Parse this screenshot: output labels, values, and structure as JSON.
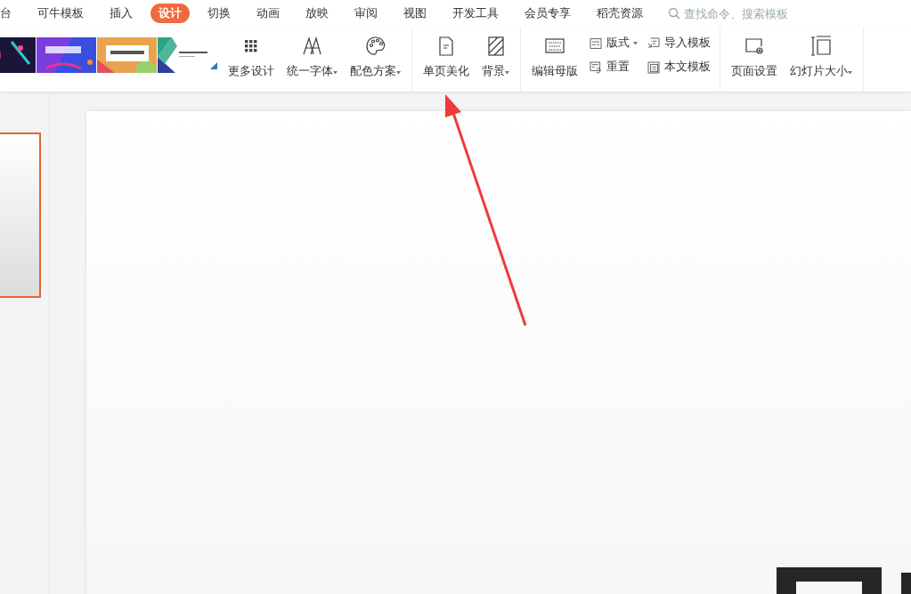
{
  "tabs": [
    {
      "label": "台",
      "selected": false
    },
    {
      "label": "可牛模板",
      "selected": false
    },
    {
      "label": "插入",
      "selected": false
    },
    {
      "label": "设计",
      "selected": true
    },
    {
      "label": "切换",
      "selected": false
    },
    {
      "label": "动画",
      "selected": false
    },
    {
      "label": "放映",
      "selected": false
    },
    {
      "label": "审阅",
      "selected": false
    },
    {
      "label": "视图",
      "selected": false
    },
    {
      "label": "开发工具",
      "selected": false
    },
    {
      "label": "会员专享",
      "selected": false
    },
    {
      "label": "稻壳资源",
      "selected": false
    }
  ],
  "search": {
    "placeholder": "查找命令、搜索模板"
  },
  "ribbon": {
    "groups": [
      {
        "items": [
          {
            "kind": "large",
            "label": "更多设计",
            "dropdown": false
          },
          {
            "kind": "large",
            "label": "统一字体",
            "dropdown": true
          },
          {
            "kind": "large",
            "label": "配色方案",
            "dropdown": true
          }
        ]
      },
      {
        "items": [
          {
            "kind": "large",
            "label": "单页美化",
            "dropdown": false
          },
          {
            "kind": "large",
            "label": "背景",
            "dropdown": true
          }
        ]
      },
      {
        "items": [
          {
            "kind": "large",
            "label": "编辑母版",
            "dropdown": false
          },
          {
            "kind": "small",
            "label": "版式",
            "dropdown": true
          },
          {
            "kind": "small",
            "label": "重置",
            "dropdown": false
          },
          {
            "kind": "small",
            "label": "导入模板",
            "dropdown": false
          },
          {
            "kind": "small",
            "label": "本文模板",
            "dropdown": false
          }
        ]
      },
      {
        "items": [
          {
            "kind": "large",
            "label": "页面设置",
            "dropdown": false
          },
          {
            "kind": "large",
            "label": "幻灯片大小",
            "dropdown": true
          }
        ]
      }
    ]
  },
  "slide_panel": {
    "thumbnail": {
      "selected": true
    }
  }
}
